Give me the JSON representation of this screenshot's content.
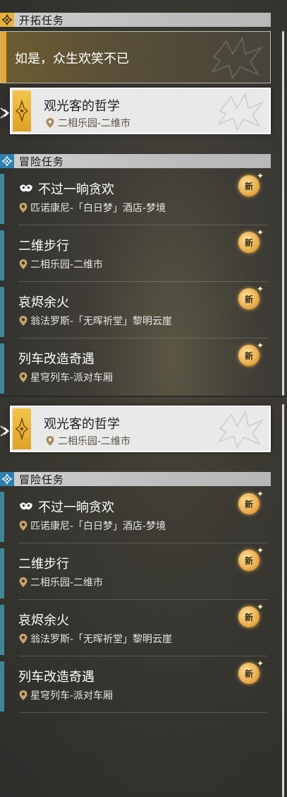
{
  "colors": {
    "gold": "#e7b13a",
    "blue_accent": "#2f7fb0",
    "teal_strip": "#3f8797"
  },
  "panel1": {
    "trailblaze_header": {
      "label": "开拓任务",
      "icon": "trailblaze-diamond-icon"
    },
    "trailblaze_quest": {
      "title": "如是，众生欢笑不已"
    },
    "selected_quest": {
      "title": "观光客的哲学",
      "location": "二相乐园-二维市"
    },
    "adventure_header": {
      "label": "冒险任务",
      "icon": "adventure-diamond-icon"
    },
    "quests": [
      {
        "title": "不过一晌贪欢",
        "location": "匹诺康尼-「白日梦」酒店-梦境",
        "badge": "新",
        "has_mask_icon": true
      },
      {
        "title": "二维步行",
        "location": "二相乐园-二维市",
        "badge": "新"
      },
      {
        "title": "哀烬余火",
        "location": "翁法罗斯-「无晖祈堂」黎明云崖",
        "badge": "新"
      },
      {
        "title": "列车改造奇遇",
        "location": "星穹列车-派对车厢",
        "badge": "新"
      }
    ]
  },
  "panel2": {
    "selected_quest": {
      "title": "观光客的哲学",
      "location": "二相乐园-二维市"
    },
    "adventure_header": {
      "label": "冒险任务",
      "icon": "adventure-diamond-icon"
    },
    "quests": [
      {
        "title": "不过一晌贪欢",
        "location": "匹诺康尼-「白日梦」酒店-梦境",
        "badge": "新",
        "has_mask_icon": true
      },
      {
        "title": "二维步行",
        "location": "二相乐园-二维市",
        "badge": "新"
      },
      {
        "title": "哀烬余火",
        "location": "翁法罗斯-「无晖祈堂」黎明云崖",
        "badge": "新"
      },
      {
        "title": "列车改造奇遇",
        "location": "星穹列车-派对车厢",
        "badge": "新"
      }
    ]
  }
}
